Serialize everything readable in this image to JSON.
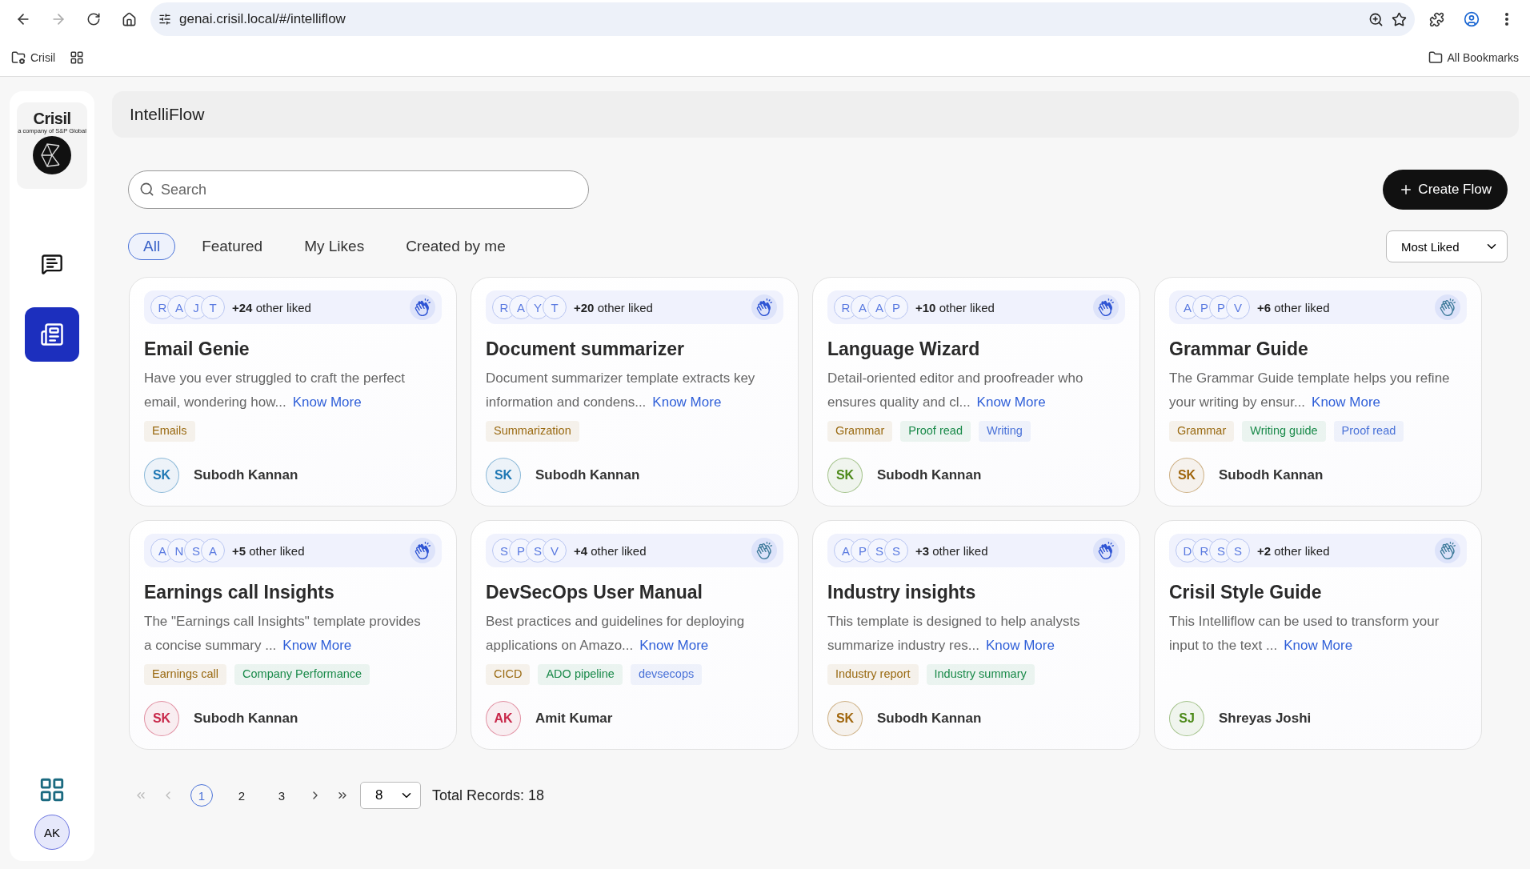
{
  "browser": {
    "url": "genai.crisil.local/#/intelliflow",
    "bookmarks": [
      {
        "kind": "folder",
        "label": "Crisil"
      },
      {
        "kind": "apps"
      }
    ],
    "all_bookmarks": "All Bookmarks"
  },
  "sidebar": {
    "logo_text": "Crisil",
    "logo_subtext": "a company of S&P Global",
    "items": [
      {
        "kind": "chat",
        "selected": false
      },
      {
        "kind": "news",
        "selected": true
      }
    ],
    "user_initials": "AK"
  },
  "header": {
    "title": "IntelliFlow"
  },
  "search": {
    "placeholder": "Search"
  },
  "create_button": "Create Flow",
  "tabs": [
    {
      "label": "All",
      "selected": true
    },
    {
      "label": "Featured",
      "selected": false
    },
    {
      "label": "My Likes",
      "selected": false
    },
    {
      "label": "Created by me",
      "selected": false
    }
  ],
  "sort": {
    "value": "Most Liked"
  },
  "cards": [
    {
      "likers": [
        "R",
        "A",
        "J",
        "T"
      ],
      "likes_count": "+24",
      "likes_text": "other liked",
      "liked": true,
      "title": "Email Genie",
      "description": "Have you ever struggled to craft the perfect email, wondering how...",
      "link": "Know More",
      "tags": [
        {
          "label": "Emails",
          "color": "#9a6a12"
        }
      ],
      "author": {
        "initials": "SK",
        "name": "Subodh Kannan",
        "color": "#1f78b4"
      }
    },
    {
      "likers": [
        "R",
        "A",
        "Y",
        "T"
      ],
      "likes_count": "+20",
      "likes_text": "other liked",
      "liked": true,
      "title": "Document summarizer",
      "description": "Document summarizer template extracts key information and condens...",
      "link": "Know More",
      "tags": [
        {
          "label": "Summarization",
          "color": "#9a6a12"
        }
      ],
      "author": {
        "initials": "SK",
        "name": "Subodh Kannan",
        "color": "#1f78b4"
      }
    },
    {
      "likers": [
        "R",
        "A",
        "A",
        "P"
      ],
      "likes_count": "+10",
      "likes_text": "other liked",
      "liked": true,
      "title": "Language Wizard",
      "description": "Detail-oriented editor and proofreader who ensures quality and cl...",
      "link": "Know More",
      "tags": [
        {
          "label": "Grammar",
          "color": "#9a6a12"
        },
        {
          "label": "Proof read",
          "color": "#1a8a4a"
        },
        {
          "label": "Writing",
          "color": "#4a72d8"
        }
      ],
      "author": {
        "initials": "SK",
        "name": "Subodh Kannan",
        "color": "#4d8a1a"
      }
    },
    {
      "likers": [
        "A",
        "P",
        "P",
        "V"
      ],
      "likes_count": "+6",
      "likes_text": "other liked",
      "liked": false,
      "title": "Grammar Guide",
      "description": "The Grammar Guide template helps you refine your writing by ensur...",
      "link": "Know More",
      "tags": [
        {
          "label": "Grammar",
          "color": "#9a6a12"
        },
        {
          "label": "Writing guide",
          "color": "#1a8a4a"
        },
        {
          "label": "Proof read",
          "color": "#4a72d8"
        }
      ],
      "author": {
        "initials": "SK",
        "name": "Subodh Kannan",
        "color": "#a0660e"
      }
    },
    {
      "likers": [
        "A",
        "N",
        "S",
        "A"
      ],
      "likes_count": "+5",
      "likes_text": "other liked",
      "liked": true,
      "title": "Earnings call Insights",
      "description": "The \"Earnings call Insights\" template provides a concise summary ...",
      "link": "Know More",
      "tags": [
        {
          "label": "Earnings call",
          "color": "#9a6a12"
        },
        {
          "label": "Company Performance",
          "color": "#1a8a4a"
        }
      ],
      "author": {
        "initials": "SK",
        "name": "Subodh Kannan",
        "color": "#c8284a"
      }
    },
    {
      "likers": [
        "S",
        "P",
        "S",
        "V"
      ],
      "likes_count": "+4",
      "likes_text": "other liked",
      "liked": false,
      "title": "DevSecOps User Manual",
      "description": "Best practices and guidelines for deploying applications on Amazo...",
      "link": "Know More",
      "tags": [
        {
          "label": "CICD",
          "color": "#9a6a12"
        },
        {
          "label": "ADO pipeline",
          "color": "#1a8a4a"
        },
        {
          "label": "devsecops",
          "color": "#4a72d8"
        }
      ],
      "author": {
        "initials": "AK",
        "name": "Amit Kumar",
        "color": "#c8284a"
      }
    },
    {
      "likers": [
        "A",
        "P",
        "S",
        "S"
      ],
      "likes_count": "+3",
      "likes_text": "other liked",
      "liked": true,
      "title": "Industry insights",
      "description": "This template is designed to help analysts summarize industry res...",
      "link": "Know More",
      "tags": [
        {
          "label": "Industry report",
          "color": "#9a6a12"
        },
        {
          "label": "Industry summary",
          "color": "#1a8a4a"
        }
      ],
      "author": {
        "initials": "SK",
        "name": "Subodh Kannan",
        "color": "#a0660e"
      }
    },
    {
      "likers": [
        "D",
        "R",
        "S",
        "S"
      ],
      "likes_count": "+2",
      "likes_text": "other liked",
      "liked": false,
      "title": "Crisil Style Guide",
      "description": "This Intelliflow can be used to transform your input to the text ...",
      "link": "Know More",
      "author": {
        "initials": "SJ",
        "name": "Shreyas Joshi",
        "color": "#4d8a1a"
      }
    }
  ],
  "pagination": {
    "first_disabled": true,
    "prev_disabled": true,
    "pages": [
      {
        "label": "1",
        "selected": true
      },
      {
        "label": "2",
        "selected": false
      },
      {
        "label": "3",
        "selected": false
      }
    ],
    "page_size": "8",
    "total": "Total Records: 18"
  }
}
